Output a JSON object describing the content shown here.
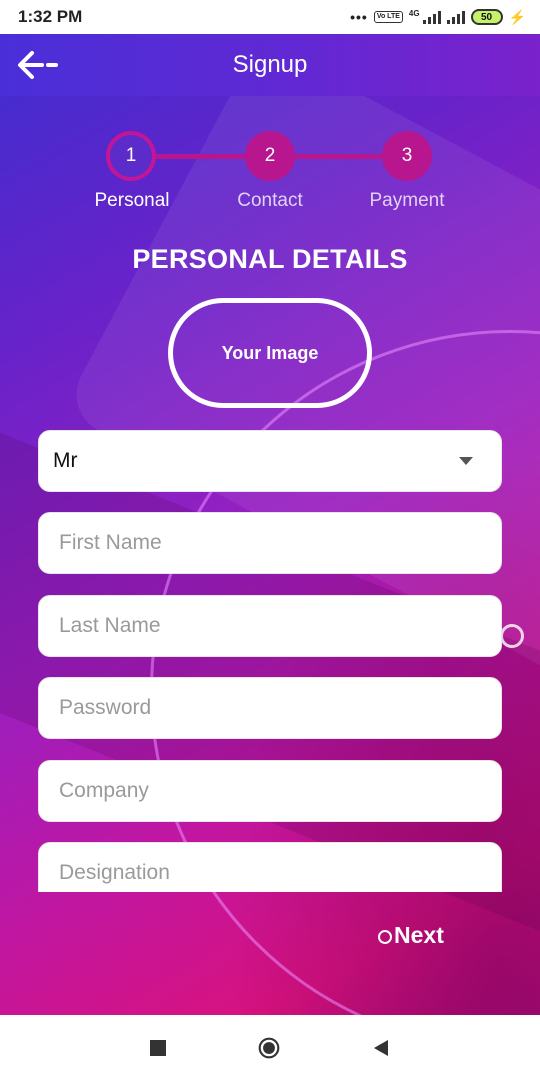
{
  "status_bar": {
    "time": "1:32 PM",
    "dots": "•••",
    "volte": "Vo LTE",
    "network": "4G",
    "battery": "50"
  },
  "app_bar": {
    "title": "Signup",
    "back_icon": "back-arrow-icon"
  },
  "stepper": {
    "steps": [
      {
        "number": "1",
        "label": "Personal",
        "active": true
      },
      {
        "number": "2",
        "label": "Contact",
        "active": false
      },
      {
        "number": "3",
        "label": "Payment",
        "active": false
      }
    ]
  },
  "section_title": "PERSONAL DETAILS",
  "image_button": "Your Image",
  "form": {
    "salutation": {
      "value": "Mr"
    },
    "first_name": {
      "placeholder": "First Name"
    },
    "last_name": {
      "placeholder": "Last Name"
    },
    "password": {
      "placeholder": "Password"
    },
    "company": {
      "placeholder": "Company"
    },
    "designation": {
      "placeholder": "Designation"
    }
  },
  "next_button": "Next",
  "nav_bar": {
    "icons": [
      "recents-square-icon",
      "home-circle-icon",
      "back-triangle-icon"
    ]
  },
  "colors": {
    "gradient_start": "#3a2fd0",
    "gradient_end": "#d8127e",
    "step_color": "#b8168e",
    "active_step": "#5b2cc9"
  }
}
